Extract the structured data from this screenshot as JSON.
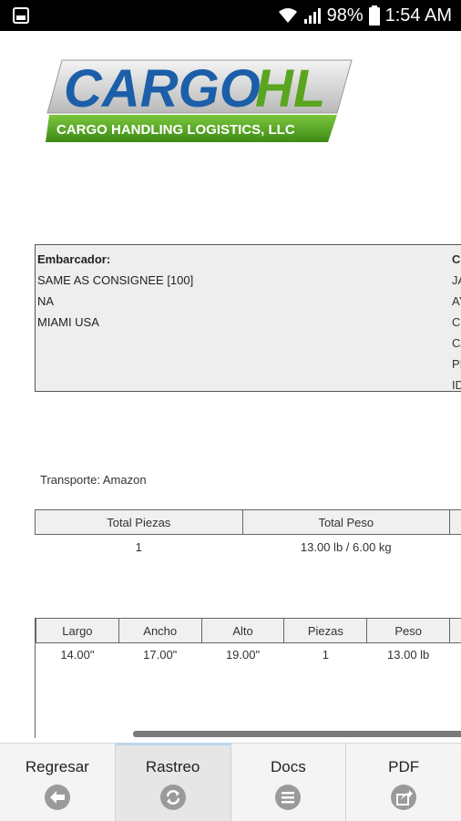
{
  "status_bar": {
    "battery": "98%",
    "time": "1:54 AM"
  },
  "logo": {
    "main_left": "CARGO",
    "main_right": "HL",
    "tagline": "CARGO HANDLING LOGISTICS, LLC"
  },
  "shipper": {
    "header": "Embarcador:",
    "lines": [
      "SAME AS CONSIGNEE [100]",
      "NA",
      "MIAMI USA"
    ]
  },
  "consignee": {
    "header": "C",
    "lines": [
      "JA",
      "AY",
      "CI",
      "CA",
      "PI",
      "ID"
    ]
  },
  "transport_label": "Transporte: Amazon",
  "totals": {
    "headers": [
      "Total Piezas",
      "Total Peso",
      ""
    ],
    "row": [
      "1",
      "13.00 lb / 6.00 kg",
      ""
    ]
  },
  "dimensions": {
    "headers": [
      "Largo",
      "Ancho",
      "Alto",
      "Piezas",
      "Peso",
      ""
    ],
    "rows": [
      [
        "14.00\"",
        "17.00\"",
        "19.00\"",
        "1",
        "13.00 lb",
        ""
      ]
    ]
  },
  "nav": [
    {
      "label": "Regresar",
      "icon": "back-arrow-icon"
    },
    {
      "label": "Rastreo",
      "icon": "refresh-icon"
    },
    {
      "label": "Docs",
      "icon": "list-icon"
    },
    {
      "label": "PDF",
      "icon": "share-icon"
    }
  ],
  "colors": {
    "nav_icon": "#9a9a9a",
    "logo_blue": "#1c5fa8",
    "logo_green": "#5aa51f"
  }
}
